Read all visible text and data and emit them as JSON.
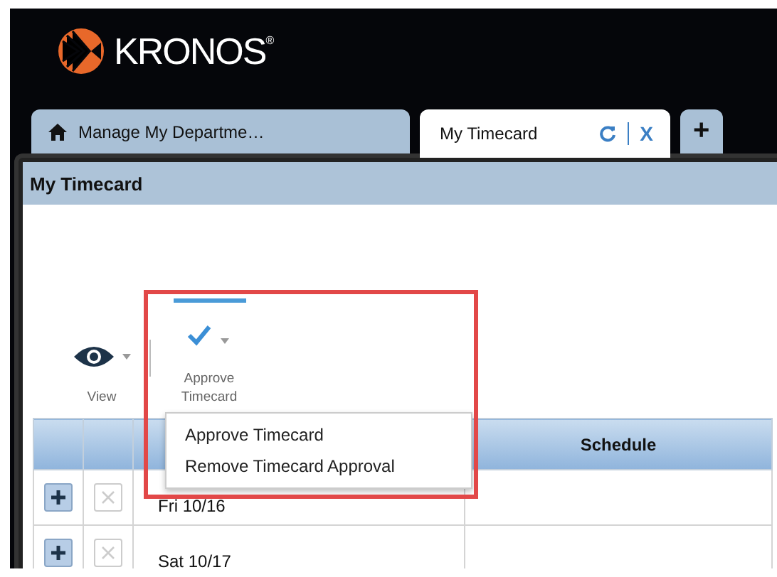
{
  "logo": {
    "text": "KRONOS$^{®}$"
  },
  "tabs": [
    {
      "label": "Manage My Departme…",
      "kind": "home",
      "selected": false
    },
    {
      "label": "My Timecard",
      "kind": "closable",
      "selected": true,
      "close": "X"
    },
    {
      "label": "+",
      "kind": "add",
      "selected": false
    }
  ],
  "panel": {
    "title": "My Timecard"
  },
  "toolbar": [
    {
      "label": "View",
      "kind": "eye",
      "selected": false
    },
    {
      "label": "Approve Timecard",
      "kind": "check",
      "selected": true
    }
  ],
  "menu": {
    "items": [
      "Approve Timecard",
      "Remove Timecard Approval"
    ]
  },
  "table": {
    "column_4": "Schedule",
    "rows": [
      {
        "date": "Fri 10/16"
      },
      {
        "date": "Sat 10/17"
      }
    ]
  }
}
